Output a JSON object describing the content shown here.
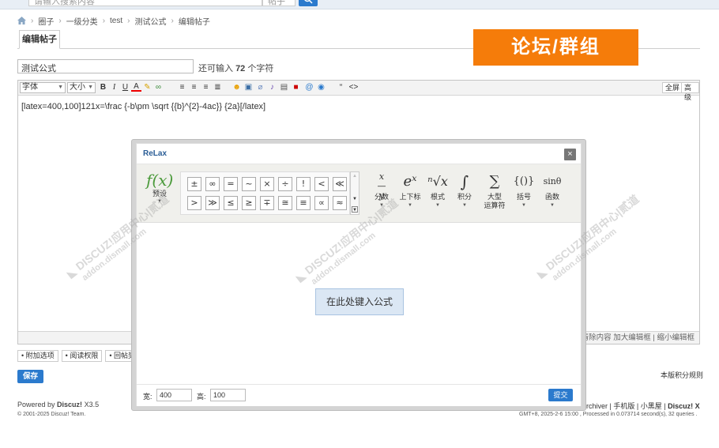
{
  "header": {
    "search_placeholder": "请输入搜索内容",
    "search_type": "帖子",
    "search_button": "搜"
  },
  "breadcrumb": [
    "圈子",
    "一级分类",
    "test",
    "测试公式",
    "编辑帖子"
  ],
  "tab": {
    "label": "编辑帖子"
  },
  "brand": {
    "text": "论坛/群组",
    "color": "#f57c0a"
  },
  "title_input": {
    "value": "测试公式"
  },
  "remaining": {
    "prefix": "还可输入",
    "count": "72",
    "suffix": "个字符"
  },
  "toolbar": {
    "font_label": "字体",
    "size_label": "大小",
    "icons": [
      "bold-icon",
      "italic-icon",
      "underline-icon",
      "font-color-icon",
      "highlight-icon",
      "link-icon",
      "align-left-icon",
      "align-center-icon",
      "align-right-icon",
      "align-justify-icon",
      "emoji-icon",
      "image-icon",
      "attachment-icon",
      "music-icon",
      "video-icon",
      "flash-icon",
      "at-icon",
      "quote-icon",
      "code-icon"
    ],
    "fullscreen": "全屏",
    "advanced": "高级"
  },
  "editor": {
    "content": "[latex=400,100]121x=\\frac {-b\\pm \\sqrt {{b}^{2}-4ac}} {2a}[/latex]",
    "status": "清除内容  加大编辑框 | 缩小编辑框"
  },
  "options": [
    "附加选项",
    "阅读权限",
    "回帖奖"
  ],
  "save_button": "保存",
  "rules_link": "本版积分规则",
  "footer": {
    "powered": "Powered by",
    "product": "Discuz!",
    "version": "X3.5",
    "copyright": "© 2001-2025 Discuz! Team.",
    "links": [
      "Archiver",
      "手机版",
      "小黑屋"
    ],
    "brand_x": "Discuz! X",
    "gmt": "GMT+8, 2025-2-6 15:00 , Processed in 0.073714 second(s), 32 queries ."
  },
  "dialog": {
    "title": "ReLax",
    "close": "×",
    "preset": {
      "glyph": "f(x)",
      "label": "预设"
    },
    "symbols": [
      "±",
      "∞",
      "=",
      "~",
      "×",
      "÷",
      "!",
      "<",
      "≪",
      ">",
      "≫",
      "≤",
      "≥",
      "∓",
      "≅",
      "≡",
      "∝",
      "≈"
    ],
    "categories": [
      {
        "glyph": "x/y",
        "label": "分数",
        "label2": ""
      },
      {
        "glyph": "eˣ",
        "label": "上下标",
        "label2": ""
      },
      {
        "glyph": "ⁿ√x",
        "label": "根式",
        "label2": ""
      },
      {
        "glyph": "∫",
        "label": "积分",
        "label2": ""
      },
      {
        "glyph": "∑",
        "label": "大型",
        "label2": "运算符"
      },
      {
        "glyph": "{()}",
        "label": "括号",
        "label2": ""
      },
      {
        "glyph": "sinθ",
        "label": "函数",
        "label2": ""
      }
    ],
    "input_hint": "在此处键入公式",
    "width_label": "宽:",
    "width_value": "400",
    "height_label": "高:",
    "height_value": "100",
    "submit": "提交"
  }
}
